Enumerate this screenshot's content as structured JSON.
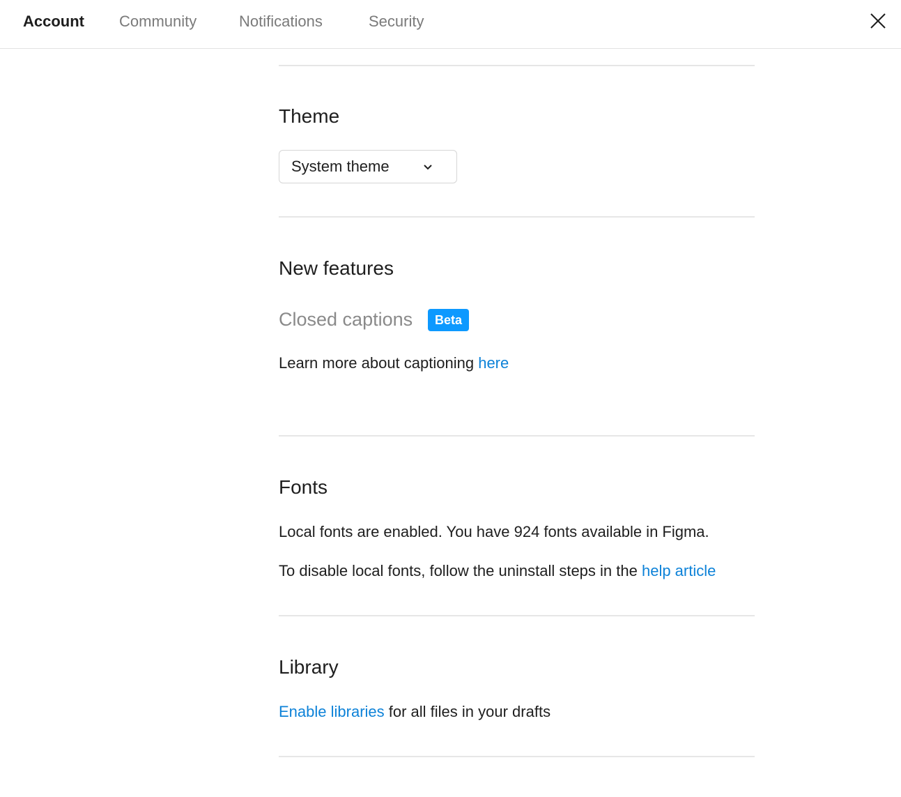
{
  "tabs": [
    {
      "label": "Account",
      "active": true
    },
    {
      "label": "Community",
      "active": false
    },
    {
      "label": "Notifications",
      "active": false
    },
    {
      "label": "Security",
      "active": false
    }
  ],
  "icons": {
    "close": "close-icon",
    "chevron": "chevron-down-icon"
  },
  "theme": {
    "heading": "Theme",
    "selected": "System theme"
  },
  "new_features": {
    "heading": "New features",
    "closed_captions_label": "Closed captions",
    "badge": "Beta",
    "learn_more_text": "Learn more about captioning ",
    "learn_more_link": "here"
  },
  "fonts": {
    "heading": "Fonts",
    "status_text": "Local fonts are enabled. You have 924 fonts available in Figma.",
    "disable_text": "To disable local fonts, follow the uninstall steps in the ",
    "disable_link": "help article"
  },
  "library": {
    "heading": "Library",
    "enable_link": "Enable libraries",
    "enable_text": " for all files in your drafts"
  },
  "colors": {
    "link": "#0d82d8",
    "badge": "#0d99ff",
    "muted_text": "#7a7a7a",
    "text": "#1e1e1e",
    "divider": "#e6e6e6"
  }
}
